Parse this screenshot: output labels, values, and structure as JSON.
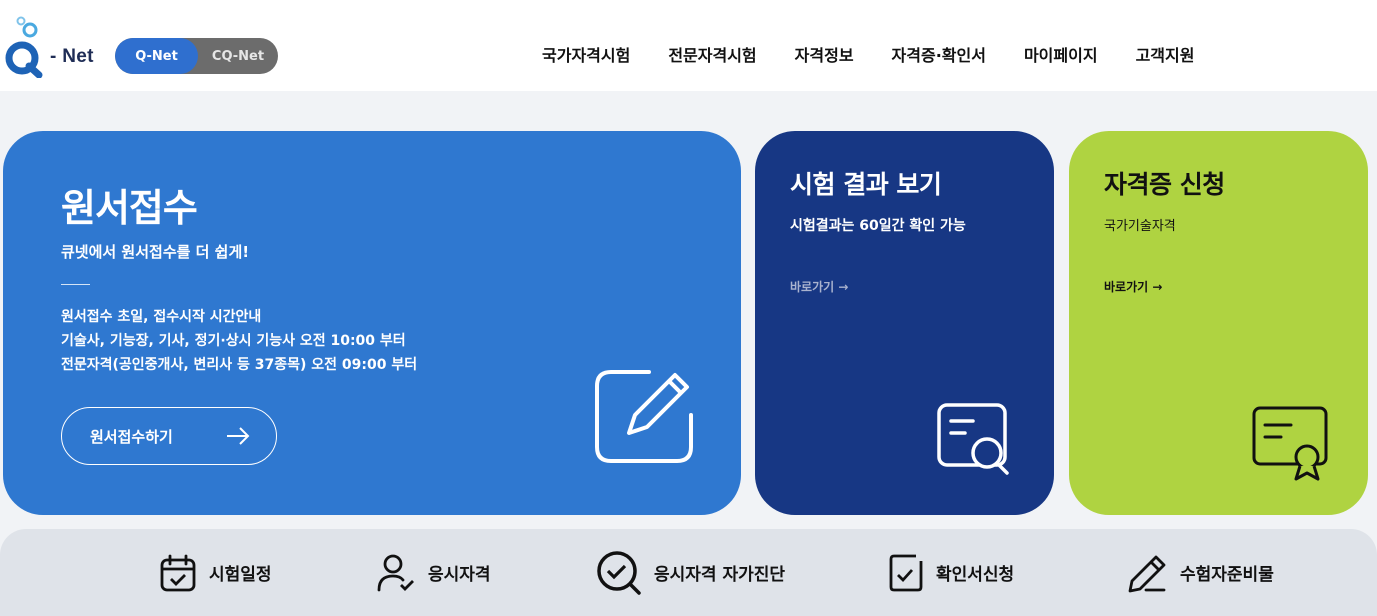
{
  "header": {
    "logo": {
      "text": "- Net",
      "letter": "Q"
    },
    "switch": {
      "on_label": "Q-Net",
      "off_label": "CQ-Net"
    },
    "nav": [
      {
        "label": "국가자격시험"
      },
      {
        "label": "전문자격시험"
      },
      {
        "label": "자격정보"
      },
      {
        "label": "자격증·확인서"
      },
      {
        "label": "마이페이지"
      },
      {
        "label": "고객지원"
      }
    ]
  },
  "apply_card": {
    "title": "원서접수",
    "subtitle": "큐넷에서 원서접수를 더 쉽게!",
    "info": [
      "원서접수 초일, 접수시작 시간안내",
      "기술사, 기능장, 기사, 정기·상시 기능사 오전 10:00 부터",
      "전문자격(공인중개사, 변리사 등 37종목) 오전 09:00 부터"
    ],
    "button_label": "원서접수하기",
    "icon": "edit-pencil-icon",
    "color": "#2f78d0"
  },
  "result_card": {
    "title": "시험 결과 보기",
    "subtitle": "시험결과는 60일간 확인 가능",
    "link_label": "바로가기 →",
    "icon": "document-search-icon",
    "color": "#173784"
  },
  "cert_card": {
    "title": "자격증 신청",
    "subtitle": "국가기술자격",
    "link_label": "바로가기 →",
    "icon": "certificate-icon",
    "color": "#afd341"
  },
  "quick_menu": [
    {
      "label": "시험일정",
      "icon": "calendar-check-icon"
    },
    {
      "label": "응시자격",
      "icon": "user-check-icon"
    },
    {
      "label": "응시자격 자가진단",
      "icon": "magnifier-check-icon"
    },
    {
      "label": "확인서신청",
      "icon": "document-check-icon"
    },
    {
      "label": "수험자준비물",
      "icon": "pencil-icon"
    }
  ]
}
